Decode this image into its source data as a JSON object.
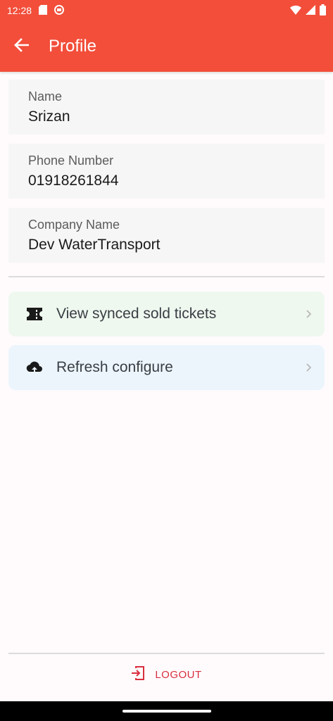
{
  "status_bar": {
    "time": "12:28",
    "left_icons": [
      "sd-card-icon",
      "notification-icon"
    ],
    "right_icons": [
      "wifi-icon",
      "signal-icon",
      "battery-icon"
    ]
  },
  "app_bar": {
    "title": "Profile",
    "back_icon": "arrow-back-icon",
    "color": "#f24e3a"
  },
  "profile": {
    "name": {
      "label": "Name",
      "value": "Srizan"
    },
    "phone": {
      "label": "Phone Number",
      "value": "01918261844"
    },
    "company": {
      "label": "Company Name",
      "value": "Dev WaterTransport"
    }
  },
  "actions": [
    {
      "label": "View synced sold tickets",
      "icon": "ticket-icon",
      "background": "#eff8ef"
    },
    {
      "label": "Refresh configure",
      "icon": "cloud-upload-icon",
      "background": "#ecf5fc"
    }
  ],
  "logout": {
    "label": "LOGOUT",
    "icon": "logout-icon",
    "color": "#d8303f"
  }
}
